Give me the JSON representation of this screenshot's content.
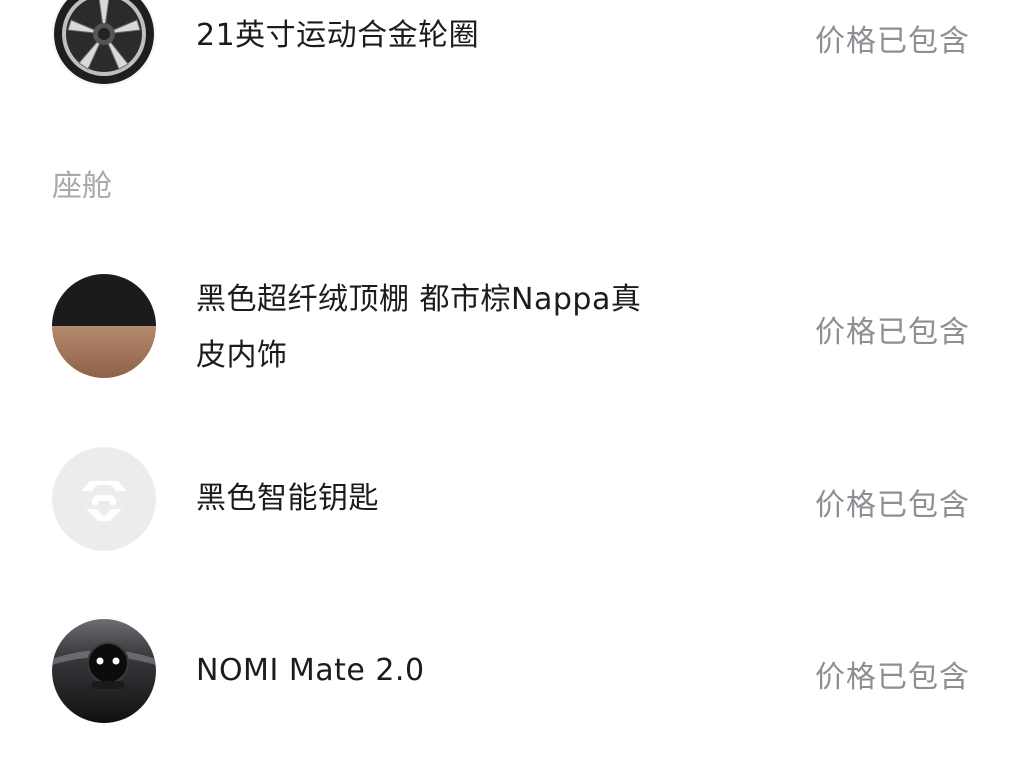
{
  "section_cabin": "座舱",
  "items": [
    {
      "name": "21英寸运动合金轮圈",
      "price": "价格已包含",
      "thumb_icon": "alloy-wheel-icon"
    },
    {
      "name_line1": "黑色超纤绒顶棚 都市棕Nappa真",
      "name_line2": "皮内饰",
      "price": "价格已包含",
      "thumb_icon": "interior-color-swatch"
    },
    {
      "name": "黑色智能钥匙",
      "price": "价格已包含",
      "thumb_icon": "smart-key-icon"
    },
    {
      "name": "NOMI Mate 2.0",
      "price": "价格已包含",
      "thumb_icon": "nomi-mate-icon"
    }
  ],
  "colors": {
    "text_primary": "#1c1c1e",
    "text_secondary": "#8e8e93",
    "section_label": "#a8a8ad",
    "background": "#ffffff"
  }
}
